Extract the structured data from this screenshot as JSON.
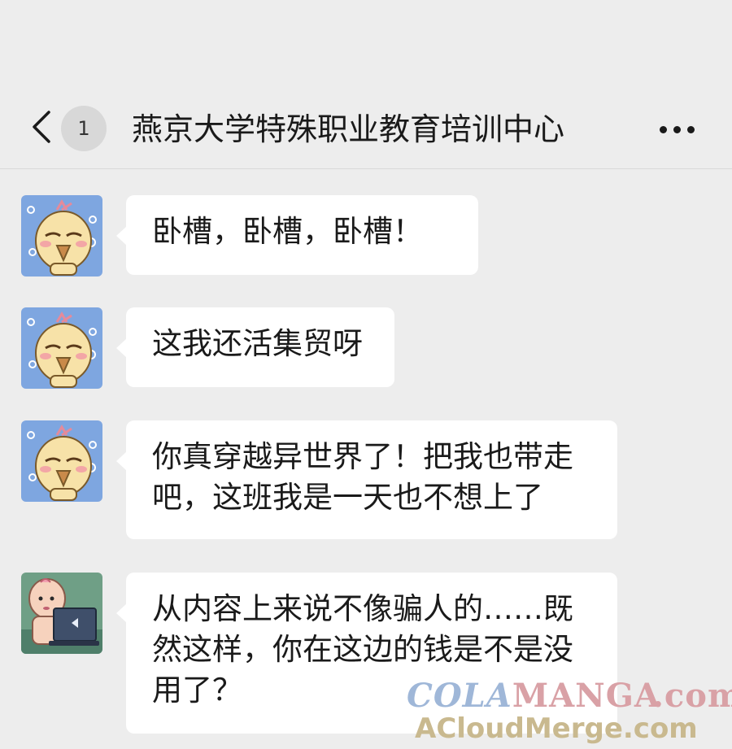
{
  "header": {
    "badge_count": "1",
    "title": "燕京大学特殊职业教育培训中心"
  },
  "messages": [
    {
      "sender": "duck-avatar",
      "text": "卧槽，卧槽，卧槽！"
    },
    {
      "sender": "duck-avatar",
      "text": "这我还活集贸呀"
    },
    {
      "sender": "duck-avatar",
      "text": "你真穿越异世界了！把我也带走吧，这班我是一天也不想上了"
    },
    {
      "sender": "baby-laptop-avatar",
      "text": "从内容上来说不像骗人的……既然这样，你在这边的钱是不是没用了？"
    }
  ],
  "watermark": {
    "cola": "COLA",
    "manga": "MANGA",
    "com": ".com",
    "site": "ACloudMerge.com"
  },
  "colors": {
    "background": "#ededed",
    "bubble": "#ffffff",
    "text": "#1a1a1a"
  }
}
